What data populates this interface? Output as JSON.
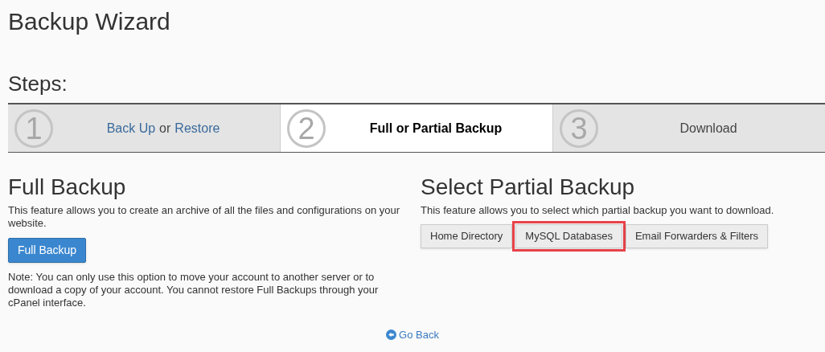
{
  "title": "Backup Wizard",
  "steps_heading": "Steps:",
  "steps": [
    {
      "number": "1",
      "selected": false,
      "parts": [
        {
          "kind": "link",
          "text": "Back Up"
        },
        {
          "kind": "text",
          "text": "or"
        },
        {
          "kind": "link",
          "text": "Restore"
        }
      ]
    },
    {
      "number": "2",
      "selected": true,
      "parts": [
        {
          "kind": "text",
          "text": "Full or Partial Backup"
        }
      ]
    },
    {
      "number": "3",
      "selected": false,
      "parts": [
        {
          "kind": "text",
          "text": "Download"
        }
      ]
    }
  ],
  "full_backup": {
    "heading": "Full Backup",
    "description": "This feature allows you to create an archive of all the files and configurations on your website.",
    "button": "Full Backup",
    "note": "Note: You can only use this option to move your account to another server or to download a copy of your account. You cannot restore Full Backups through your cPanel interface."
  },
  "partial_backup": {
    "heading": "Select Partial Backup",
    "description": "This feature allows you to select which partial backup you want to download.",
    "buttons": [
      {
        "label": "Home Directory",
        "highlighted": false
      },
      {
        "label": "MySQL Databases",
        "highlighted": true
      },
      {
        "label": "Email Forwarders & Filters",
        "highlighted": false
      }
    ]
  },
  "go_back": "Go Back"
}
